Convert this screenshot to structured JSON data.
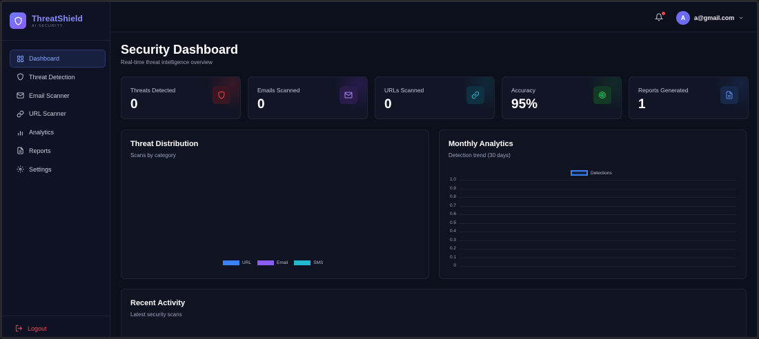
{
  "brand": {
    "name": "ThreatShield",
    "tagline": "AI SECURITY"
  },
  "sidebar": {
    "items": [
      {
        "label": "Dashboard",
        "icon": "grid-icon",
        "active": true
      },
      {
        "label": "Threat Detection",
        "icon": "shield-icon",
        "active": false
      },
      {
        "label": "Email Scanner",
        "icon": "mail-icon",
        "active": false
      },
      {
        "label": "URL Scanner",
        "icon": "link-icon",
        "active": false
      },
      {
        "label": "Analytics",
        "icon": "bar-chart-icon",
        "active": false
      },
      {
        "label": "Reports",
        "icon": "document-icon",
        "active": false
      },
      {
        "label": "Settings",
        "icon": "gear-icon",
        "active": false
      }
    ],
    "logout_label": "Logout"
  },
  "topbar": {
    "user_initial": "A",
    "user_email": "a@gmail.com",
    "has_notification": true
  },
  "page": {
    "title": "Security Dashboard",
    "subtitle": "Real-time threat intelligence overview"
  },
  "stats": [
    {
      "label": "Threats Detected",
      "value": "0",
      "icon": "shield-icon",
      "color": "#ef4444"
    },
    {
      "label": "Emails Scanned",
      "value": "0",
      "icon": "mail-icon",
      "color": "#8b5cf6"
    },
    {
      "label": "URLs Scanned",
      "value": "0",
      "icon": "link-icon",
      "color": "#22b8cf"
    },
    {
      "label": "Accuracy",
      "value": "95%",
      "icon": "target-icon",
      "color": "#22c55e"
    },
    {
      "label": "Reports Generated",
      "value": "1",
      "icon": "document-icon",
      "color": "#3b6fd8"
    }
  ],
  "threat_distribution": {
    "title": "Threat Distribution",
    "subtitle": "Scans by category",
    "legend": [
      {
        "label": "URL",
        "color": "#3b82f6"
      },
      {
        "label": "Email",
        "color": "#8b5cf6"
      },
      {
        "label": "SMS",
        "color": "#22b8cf"
      }
    ]
  },
  "monthly_analytics": {
    "title": "Monthly Analytics",
    "subtitle": "Detection trend (30 days)",
    "legend_label": "Detections",
    "legend_color": "#3b82f6",
    "y_ticks": [
      "1.0",
      "0.9",
      "0.8",
      "0.7",
      "0.6",
      "0.5",
      "0.4",
      "0.3",
      "0.2",
      "0.1",
      "0"
    ]
  },
  "chart_data": {
    "type": "line",
    "title": "Monthly Analytics",
    "series": [
      {
        "name": "Detections",
        "values": []
      }
    ],
    "ylim": [
      0,
      1.0
    ],
    "grid": true,
    "legend": "top"
  },
  "recent_activity": {
    "title": "Recent Activity",
    "subtitle": "Latest security scans"
  }
}
